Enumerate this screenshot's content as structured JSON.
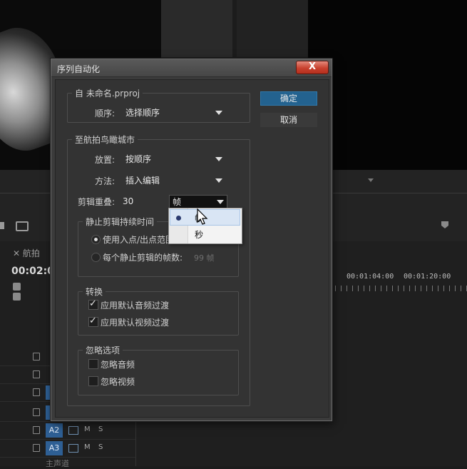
{
  "dialog": {
    "title": "序列自动化",
    "close_label": "X",
    "ok_label": "确定",
    "cancel_label": "取消",
    "from_group": {
      "legend": "自 未命名.prproj",
      "ordering_label": "顺序:",
      "ordering_value": "选择顺序"
    },
    "to_group": {
      "legend": "至航拍鸟瞰城市",
      "placement_label": "放置:",
      "placement_value": "按顺序",
      "method_label": "方法:",
      "method_value": "插入编辑",
      "overlap_label": "剪辑重叠:",
      "overlap_value": "30",
      "overlap_unit": "帧",
      "still_group": {
        "legend": "静止剪辑持续时间",
        "opt_in_out": "使用入点/出点范围",
        "opt_frames": "每个静止剪辑的帧数:",
        "frames_value": "99 帧"
      },
      "transitions_group": {
        "legend": "转换",
        "audio_label": "应用默认音频过渡",
        "video_label": "应用默认视频过渡"
      },
      "ignore_group": {
        "legend": "忽略选项",
        "ignore_audio": "忽略音频",
        "ignore_video": "忽略视频"
      }
    },
    "unit_popup": {
      "items": [
        "帧",
        "秒"
      ],
      "selected": "帧"
    }
  },
  "timeline": {
    "tab_label": "航拍",
    "timecode": "00:02:0",
    "ruler": [
      "00:01:04:00",
      "00:01:20:00"
    ],
    "tracks": [
      {
        "name": "",
        "m": "",
        "s": ""
      },
      {
        "name": "",
        "m": "",
        "s": ""
      },
      {
        "name": "",
        "m": "",
        "s": ""
      },
      {
        "name": "",
        "m": "",
        "s": ""
      },
      {
        "name": "A2",
        "m": "M",
        "s": "S"
      },
      {
        "name": "A3",
        "m": "M",
        "s": "S"
      }
    ],
    "master_label": "主声道"
  }
}
